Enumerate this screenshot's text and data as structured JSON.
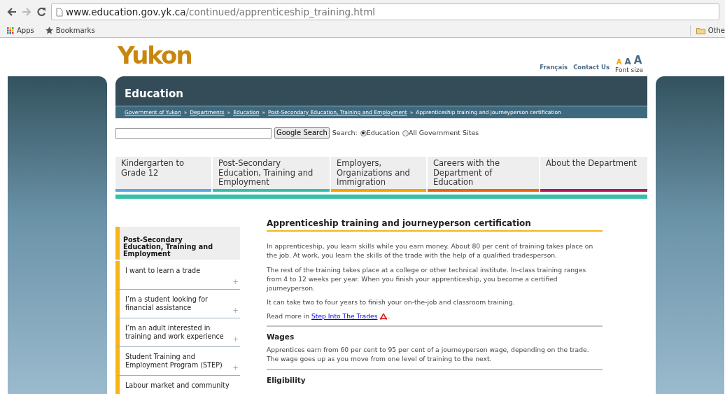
{
  "browser": {
    "url_host": "www.education.gov.yk.ca",
    "url_path": "/continued/apprenticeship_training.html",
    "bookmarks": [
      {
        "kind": "apps",
        "label": "Apps"
      },
      {
        "kind": "star",
        "label": "Bookmarks"
      }
    ],
    "other_bookmarks": "Othe"
  },
  "header": {
    "logo": "Yukon",
    "font_size_buttons": [
      {
        "label": "A",
        "selected": true
      },
      {
        "label": "A",
        "selected": false
      },
      {
        "label": "A",
        "selected": false
      }
    ],
    "font_size_label": "Font size",
    "links": [
      "Français",
      "Contact Us"
    ]
  },
  "banner": {
    "title": "Education"
  },
  "breadcrumb": [
    {
      "label": "Government of Yukon",
      "link": true
    },
    {
      "label": "Departments",
      "link": true
    },
    {
      "label": "Education",
      "link": true
    },
    {
      "label": "Post-Secondary Education, Training and Employment",
      "link": true
    },
    {
      "label": "Apprenticeship training and journeyperson certification",
      "link": false
    }
  ],
  "breadcrumb_separator": "»",
  "search": {
    "button": "Google Search",
    "label": "Search:",
    "options": [
      {
        "label": "Education",
        "selected": true
      },
      {
        "label": "All Government Sites",
        "selected": false
      }
    ]
  },
  "nav_tabs": [
    {
      "label": "Kindergarten to Grade 12",
      "color": "#5aa6e0"
    },
    {
      "label": "Post-Secondary Education, Training and Employment",
      "color": "#35c0a6"
    },
    {
      "label": "Employers, Organizations and Immigration",
      "color": "#f5a100"
    },
    {
      "label": "Careers with the Department of Education",
      "color": "#e8650d"
    },
    {
      "label": "About the Department",
      "color": "#b0185a"
    }
  ],
  "sidebar": {
    "title": "Post-Secondary Education, Training and Employment",
    "items": [
      {
        "label": "I want to learn a trade",
        "expander": "+"
      },
      {
        "label": "I’m a student looking for financial assistance",
        "expander": "+"
      },
      {
        "label": "I’m an adult interested in training and work experience",
        "expander": "+"
      },
      {
        "label": "Student Training and Employment Program (STEP)",
        "expander": "+"
      },
      {
        "label": "Labour market and community"
      }
    ]
  },
  "article": {
    "title": "Apprenticeship training and journeyperson certification",
    "paragraphs": [
      "In apprenticeship, you learn skills while you earn money. About 80 per cent of training takes place on the job. At work, you learn the skills of the trade with the help of a qualified tradesperson.",
      "The rest of the training takes place at a college or other technical institute. In-class training ranges from 4 to 12 weeks per year. When you finish your apprenticeship, you become a certified journeyperson.",
      "It can take two to four years to finish your on-the-job and classroom training."
    ],
    "read_more": {
      "prefix": "Read more in",
      "link": "Step Into The Trades",
      "suffix": "."
    },
    "sections": [
      {
        "heading": "Wages",
        "paragraphs": [
          "Apprentices earn from 60 per cent to 95 per cent of a journeyperson wage, depending on the trade. The wage goes up as you move from one level of training to the next."
        ]
      },
      {
        "heading": "Eligibility"
      }
    ]
  }
}
